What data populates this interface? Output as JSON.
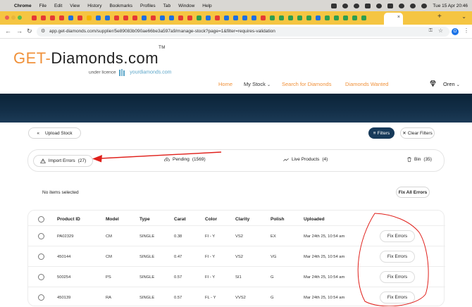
{
  "menubar": {
    "app": "Chrome",
    "items": [
      "File",
      "Edit",
      "View",
      "History",
      "Bookmarks",
      "Profiles",
      "Tab",
      "Window",
      "Help"
    ],
    "clock": "Tue 15 Apr  20:46"
  },
  "tab_strip": {
    "tab_icon_colors": [
      "#e53935",
      "#e53935",
      "#e53935",
      "#e53935",
      "#1e6fe0",
      "#e53935",
      "#f5b400",
      "#1e6fe0",
      "#1e6fe0",
      "#e53935",
      "#e53935",
      "#e53935",
      "#1e6fe0",
      "#e53935",
      "#1e6fe0",
      "#1e6fe0",
      "#e53935",
      "#e53935",
      "#2e9e4f",
      "#1e6fe0",
      "#e53935",
      "#1e6fe0",
      "#1e6fe0",
      "#1e6fe0",
      "#1e6fe0",
      "#e53935",
      "#2e9e4f",
      "#2e9e4f",
      "#2e9e4f",
      "#2e9e4f",
      "#2e9e4f",
      "#1e6fe0",
      "#2e9e4f",
      "#2e9e4f",
      "#2e9e4f",
      "#2e9e4f",
      "#2e9e4f"
    ],
    "close_glyph": "×",
    "new_tab_glyph": "+"
  },
  "browser": {
    "url": "app.get-diamonds.com/supplier/5e89083b090ae66be3a597a9/manage-stock?page=1&filter=requires-validation",
    "profile_initial": "O"
  },
  "site": {
    "logo_part1": "GET-",
    "logo_part2": "Diamonds.com",
    "logo_tm": "TM",
    "licence_text": "under licence",
    "licence_brand": "yourdiamonds.com",
    "nav": {
      "home": "Home",
      "my_stock": "My Stock",
      "my_stock_caret": "⌄",
      "search": "Search for Diamonds",
      "wanted": "Diamonds Wanted",
      "user": "Oren"
    }
  },
  "actions": {
    "upload": "Upload Stock",
    "upload_glyph": "«",
    "filters": "Filters",
    "clear_filters": "Clear Filters"
  },
  "status_tabs": {
    "import_errors": "Import Errors",
    "import_errors_count": "(27)",
    "pending": "Pending",
    "pending_count": "(1569)",
    "live": "Live Products",
    "live_count": "(4)",
    "bin": "Bin",
    "bin_count": "(35)"
  },
  "selection": {
    "none_selected": "No items selected",
    "fix_all": "Fix All Errors"
  },
  "table": {
    "headers": {
      "product_id": "Product ID",
      "model": "Model",
      "type": "Type",
      "carat": "Carat",
      "color": "Color",
      "clarity": "Clarity",
      "polish": "Polish",
      "uploaded": "Uploaded"
    },
    "rows": [
      {
        "product_id": "PA02329",
        "model": "CM",
        "type": "SINGLE",
        "carat": "0.38",
        "color": "FI - Y",
        "clarity": "VS2",
        "polish": "EX",
        "uploaded": "Mar 24th 25, 10:54 am",
        "action": "Fix Errors"
      },
      {
        "product_id": "450144",
        "model": "CM",
        "type": "SINGLE",
        "carat": "0.47",
        "color": "FI - Y",
        "clarity": "VS2",
        "polish": "VG",
        "uploaded": "Mar 24th 25, 10:54 am",
        "action": "Fix Errors"
      },
      {
        "product_id": "500254",
        "model": "PS",
        "type": "SINGLE",
        "carat": "0.57",
        "color": "FI - Y",
        "clarity": "SI1",
        "polish": "G",
        "uploaded": "Mar 24th 25, 10:54 am",
        "action": "Fix Errors"
      },
      {
        "product_id": "450139",
        "model": "RA",
        "type": "SINGLE",
        "carat": "0.57",
        "color": "FL - Y",
        "clarity": "VVS2",
        "polish": "G",
        "uploaded": "Mar 24th 25, 10:54 am",
        "action": "Fix Errors"
      }
    ]
  },
  "colors": {
    "brand_orange": "#f0913a",
    "navy": "#173a5a",
    "annotation_red": "#e0201b",
    "tab_strip": "#f5c542"
  }
}
